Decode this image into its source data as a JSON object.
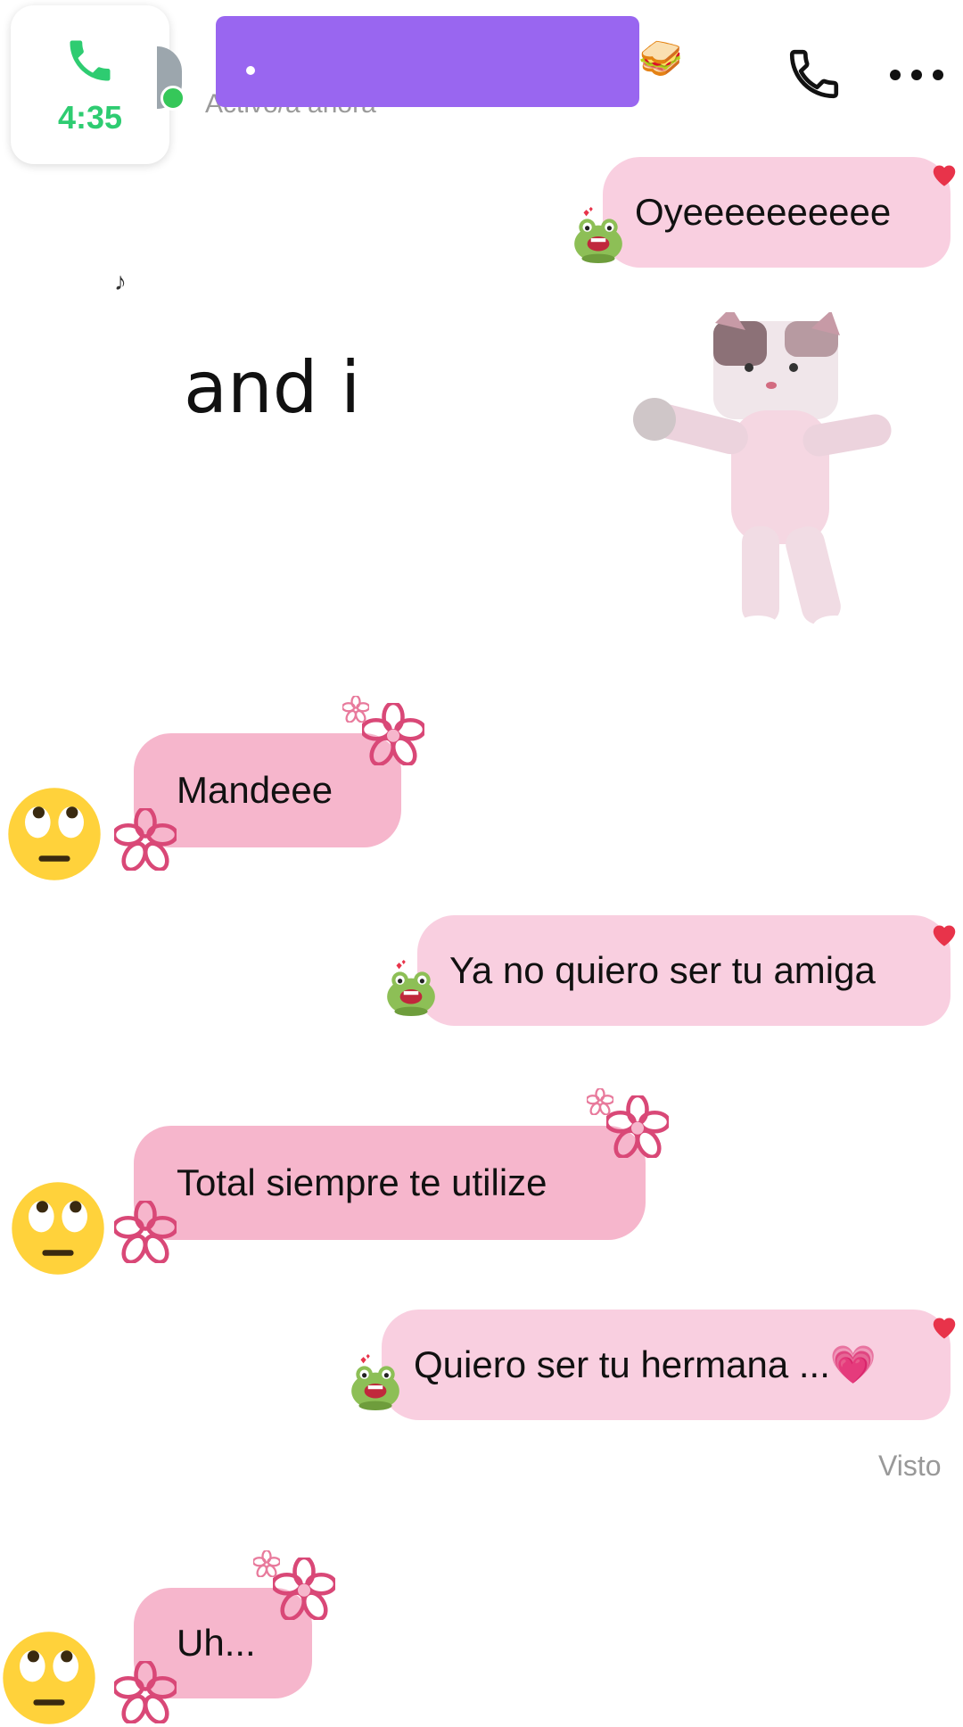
{
  "call": {
    "timer": "4:35",
    "icon": "phone-icon"
  },
  "header": {
    "status": "Activo/a ahora",
    "contact_emoji": "🥪",
    "call_icon": "phone-outline-icon",
    "more_icon": "ellipsis-icon"
  },
  "sticker": {
    "caption": "and i",
    "watermark_icon": "tiktok-icon"
  },
  "messages": [
    {
      "side": "sent",
      "text": "Oyeeeeeeeeee"
    },
    {
      "side": "received",
      "text": "Mandeee"
    },
    {
      "side": "sent",
      "text": "Ya no quiero ser tu amiga"
    },
    {
      "side": "received",
      "text": "Total siempre te utilize"
    },
    {
      "side": "sent",
      "text": "Quiero ser tu hermana ...💗"
    },
    {
      "side": "received",
      "text": "Uh..."
    }
  ],
  "seen_label": "Visto",
  "colors": {
    "sent_bubble": "#f9cfe0",
    "received_bubble": "#f6b6cc",
    "redaction": "#9966f0",
    "call_green": "#2ecc71"
  }
}
